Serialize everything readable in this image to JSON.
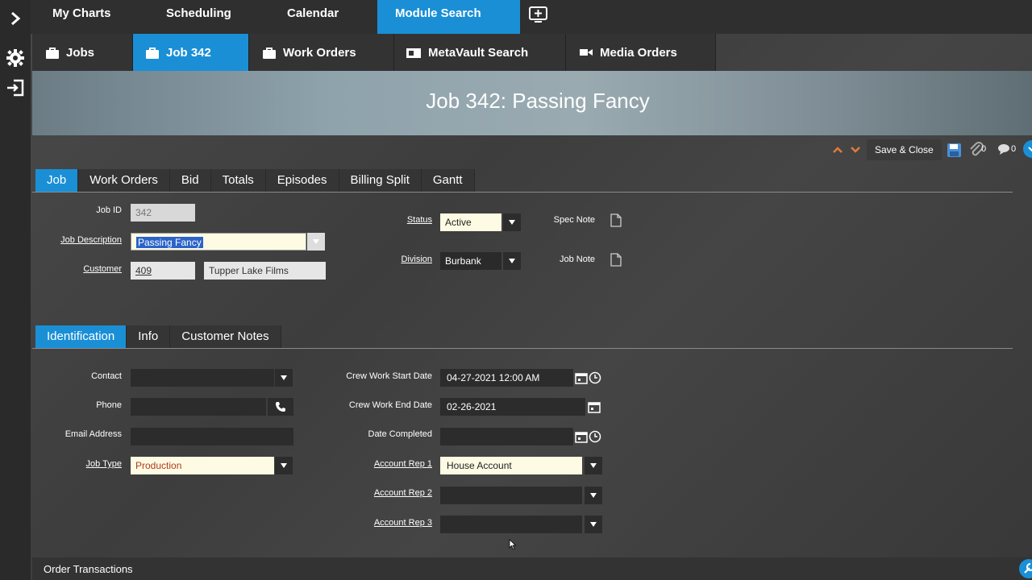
{
  "top_nav": [
    "My Charts",
    "Scheduling",
    "Calendar",
    "Module Search"
  ],
  "sub_nav": [
    "Jobs",
    "Job 342",
    "Work Orders",
    "MetaVault Search",
    "Media Orders"
  ],
  "banner_title": "Job 342: Passing Fancy",
  "toolbar": {
    "save_close": "Save & Close",
    "attach_count": "0",
    "comment_count": "0"
  },
  "job_tabs": [
    "Job",
    "Work Orders",
    "Bid",
    "Totals",
    "Episodes",
    "Billing Split",
    "Gantt"
  ],
  "job_form": {
    "job_id_label": "Job ID",
    "job_id": "342",
    "job_desc_label": "Job Description",
    "job_desc": "Passing Fancy",
    "customer_label": "Customer",
    "customer_id": "409",
    "customer_name": "Tupper Lake Films",
    "status_label": "Status",
    "status": "Active",
    "division_label": "Division",
    "division": "Burbank",
    "spec_note_label": "Spec Note",
    "job_note_label": "Job Note"
  },
  "id_tabs": [
    "Identification",
    "Info",
    "Customer Notes"
  ],
  "ident": {
    "contact_label": "Contact",
    "contact": "",
    "phone_label": "Phone",
    "phone": "",
    "email_label": "Email Address",
    "email": "",
    "job_type_label": "Job Type",
    "job_type": "Production",
    "crew_start_label": "Crew Work Start Date",
    "crew_start": "04-27-2021 12:00 AM",
    "crew_end_label": "Crew Work End Date",
    "crew_end": "02-26-2021",
    "date_completed_label": "Date Completed",
    "date_completed": "",
    "rep1_label": "Account Rep 1",
    "rep1": "House Account",
    "rep2_label": "Account Rep 2",
    "rep2": "",
    "rep3_label": "Account Rep 3",
    "rep3": ""
  },
  "bottom_label": "Order Transactions"
}
